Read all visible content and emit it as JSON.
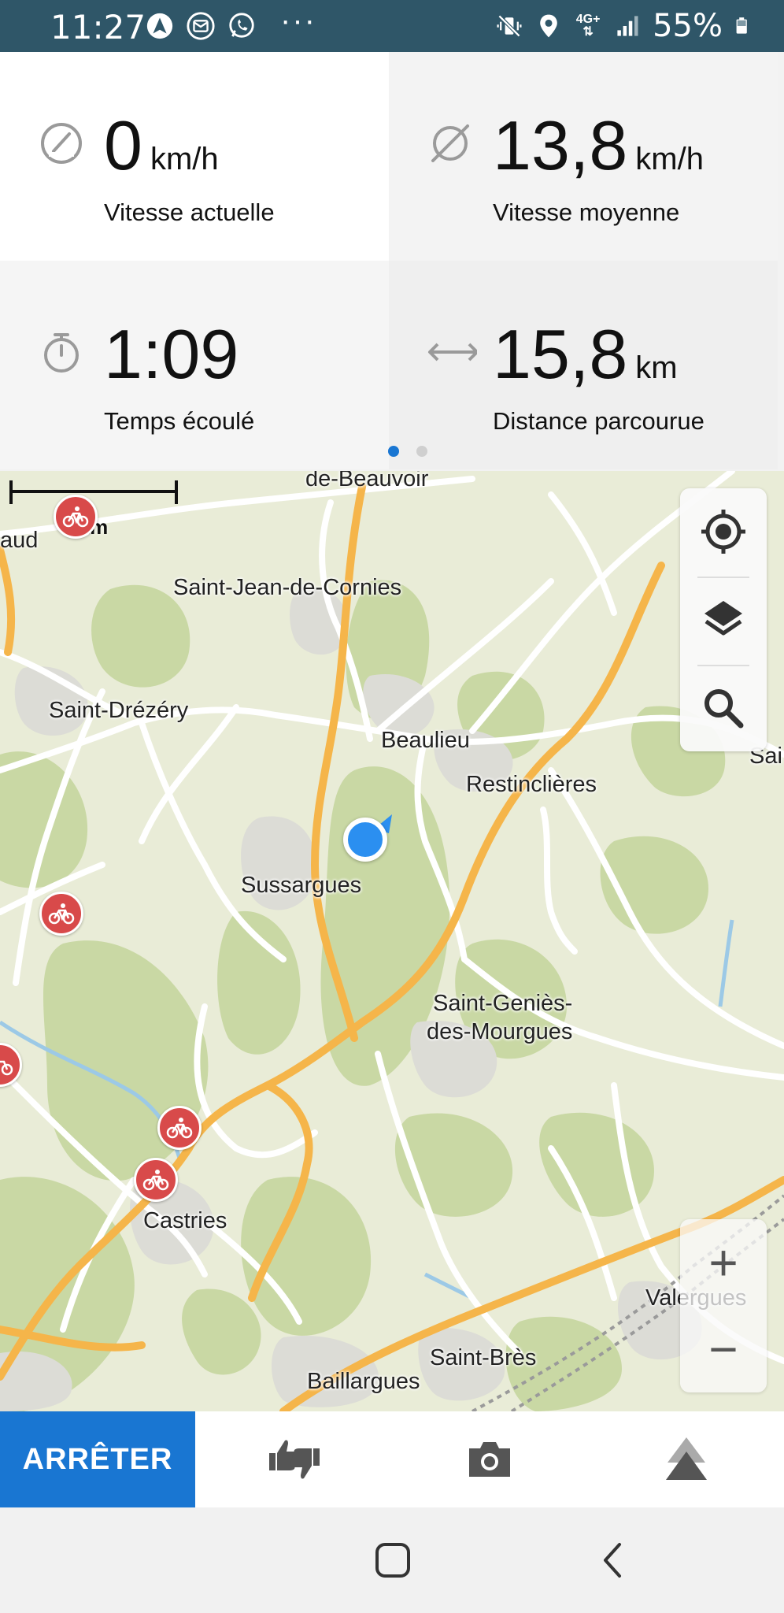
{
  "status_bar": {
    "time": "11:27",
    "left_icons": [
      "navigation-app-icon",
      "email-icon",
      "whatsapp-icon"
    ],
    "more": "···",
    "network": "4G+",
    "battery": "55%",
    "right_icons": [
      "vibrate-mute-icon",
      "location-icon",
      "network-icon",
      "signal-icon",
      "battery-icon"
    ]
  },
  "stats": {
    "current_speed": {
      "value": "0",
      "unit": "km/h",
      "label": "Vitesse actuelle",
      "icon": "speedometer-icon"
    },
    "average_speed": {
      "value": "13,8",
      "unit": "km/h",
      "label": "Vitesse moyenne",
      "icon": "average-icon"
    },
    "elapsed_time": {
      "value": "1:09",
      "unit": "",
      "label": "Temps écoulé",
      "icon": "stopwatch-icon"
    },
    "distance": {
      "value": "15,8",
      "unit": "km",
      "label": "Distance parcourue",
      "icon": "distance-arrows-icon"
    },
    "pager": {
      "pages": 2,
      "active": 1
    }
  },
  "map": {
    "scale_label": "2 km",
    "places": {
      "p1": "de-Beauvoir",
      "p2": "aud",
      "p3": "Saint-Jean-de-Cornies",
      "p4": "Saint-Drézéry",
      "p5": "Beaulieu",
      "p6": "Restinclières",
      "p7": "Sai",
      "p8": "Sussargues",
      "p9": "Saint-Geniès-",
      "p10": "des-Mourgues",
      "p11": "Castries",
      "p12": "Valergues",
      "p13": "Saint-Brès",
      "p14": "Baillargues"
    },
    "controls": {
      "locate": "crosshair-icon",
      "layers": "layers-icon",
      "search": "search-icon",
      "zoom_in": "+",
      "zoom_out": "−"
    },
    "colors": {
      "background": "#e9ecd7",
      "forest": "#c9d8a4",
      "road": "#ffffff",
      "major_road": "#f5b54a",
      "urban": "#dcdcd6",
      "poi": "#d84a4a",
      "location": "#2b8ff0"
    }
  },
  "action_bar": {
    "stop_label": "ARRÊTER",
    "rate_icon": "thumbs-up-down-icon",
    "camera_icon": "camera-icon",
    "elevation_icon": "elevation-icon",
    "accent": "#1976d2"
  },
  "nav_bar": {
    "home_icon": "home-square-icon",
    "back_icon": "back-chevron-icon"
  }
}
